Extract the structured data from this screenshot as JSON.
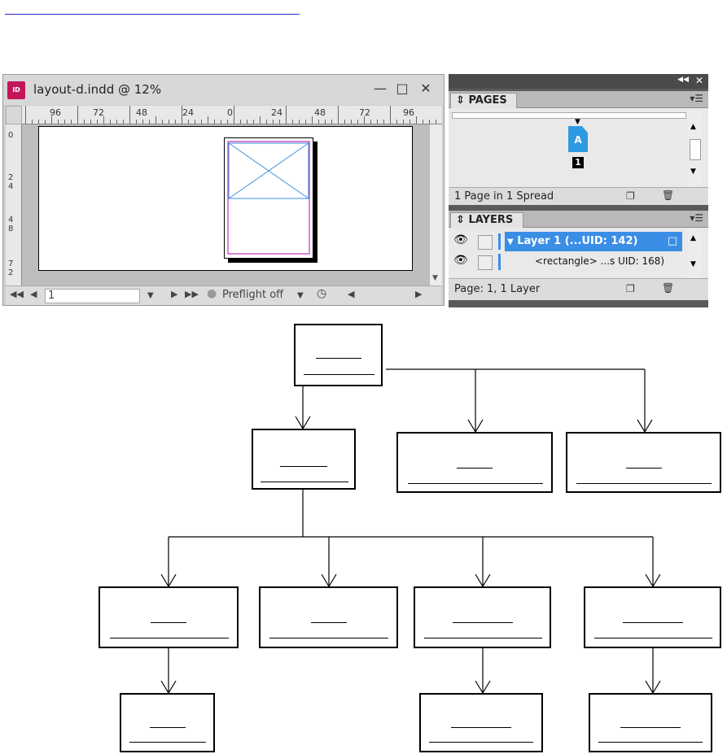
{
  "document_window": {
    "title": "layout-d.indd @ 12%",
    "ruler_labels": [
      "96",
      "72",
      "48",
      "24",
      "0",
      "24",
      "48",
      "72",
      "96"
    ],
    "vertical_ruler_labels": [
      "0",
      "2\n4",
      "4\n8",
      "7\n2"
    ],
    "page_field": "1",
    "preflight": "Preflight off"
  },
  "pages_panel": {
    "tab": "PAGES",
    "master_letter": "A",
    "page_number": "1",
    "status": "1 Page in 1 Spread"
  },
  "layers_panel": {
    "tab": "LAYERS",
    "rows": [
      {
        "label": "Layer 1 (...UID: 142)",
        "selected": true
      },
      {
        "label": "<rectangle> ...s UID: 168)",
        "selected": false
      }
    ],
    "status": "Page: 1, 1 Layer"
  },
  "colors": {
    "layer_highlight": "#3b8ee6",
    "page_icon": "#2e9be0",
    "margin": "#c030c0",
    "frame_x": "#3a8ee0"
  }
}
